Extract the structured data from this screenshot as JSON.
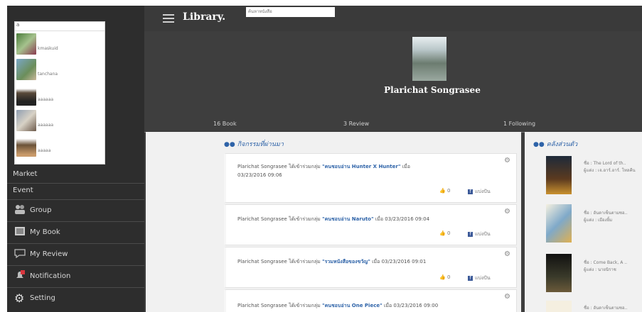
{
  "app": {
    "title": "Library.",
    "search_placeholder": "ค้นหาหนังสือ"
  },
  "sidebar": {
    "friend_search": "a",
    "friends": [
      {
        "name": "kmaskuid"
      },
      {
        "name": "tanchana"
      },
      {
        "name": "aaaaaa"
      },
      {
        "name": "aaaaaa"
      },
      {
        "name": "aaaaa"
      }
    ],
    "menu": [
      {
        "label": "Market"
      },
      {
        "label": "Event"
      },
      {
        "label": "Group"
      },
      {
        "label": "My Book"
      },
      {
        "label": "My Review"
      },
      {
        "label": "Notification"
      },
      {
        "label": "Setting"
      }
    ]
  },
  "profile": {
    "name": "Plarichat Songrasee",
    "stats": {
      "books": "16 Book",
      "reviews": "3 Review",
      "following": "1 Following"
    }
  },
  "activity": {
    "heading": "กิจกรรมที่ผ่านมา",
    "items": [
      {
        "pre": "Plarichat Songrasee ได้เข้าร่วมกลุ่ม ",
        "group": "\"คนชอบอ่าน Hunter X Hunter\"",
        "post": " เมื่อ",
        "line2": "03/23/2016 09:06",
        "like": "0",
        "share": "แบ่งปัน"
      },
      {
        "pre": "Plarichat Songrasee ได้เข้าร่วมกลุ่ม ",
        "group": "\"คนชอบอ่าน Naruto\"",
        "post": " เมื่อ 03/23/2016 09:04",
        "line2": "",
        "like": "0",
        "share": "แบ่งปัน"
      },
      {
        "pre": "Plarichat Songrasee ได้เข้าร่วมกลุ่ม ",
        "group": "\"รวมหนังสือของขวัญ\"",
        "post": " เมื่อ 03/23/2016 09:01",
        "line2": "",
        "like": "0",
        "share": "แบ่งปัน"
      },
      {
        "pre": "Plarichat Songrasee ได้เข้าร่วมกลุ่ม ",
        "group": "\"คนชอบอ่าน One Piece\"",
        "post": " เมื่อ 03/23/2016 09:00",
        "line2": "",
        "like": "",
        "share": ""
      }
    ]
  },
  "shelf": {
    "heading": "คลังส่วนตัว",
    "books": [
      {
        "title": "ชื่อ : The Lord of th..",
        "author": "ผู้แต่ง : เจ.อาร์.อาร์. โทลคีน"
      },
      {
        "title": "ชื่อ : อันดาเซ็นตามซอ..",
        "author": "ผู้แต่ง : เมืองยิ้ม"
      },
      {
        "title": "ชื่อ : Come Back, A ..",
        "author": "ผู้แต่ง : นายนิราช"
      },
      {
        "title": "ชื่อ : อันดาเซ็นตามซอ..",
        "author": ""
      }
    ]
  },
  "colors": {
    "link": "#2e63a8",
    "sidebar_bg": "#2d2d2d",
    "content_bg": "#f1f1f1"
  }
}
